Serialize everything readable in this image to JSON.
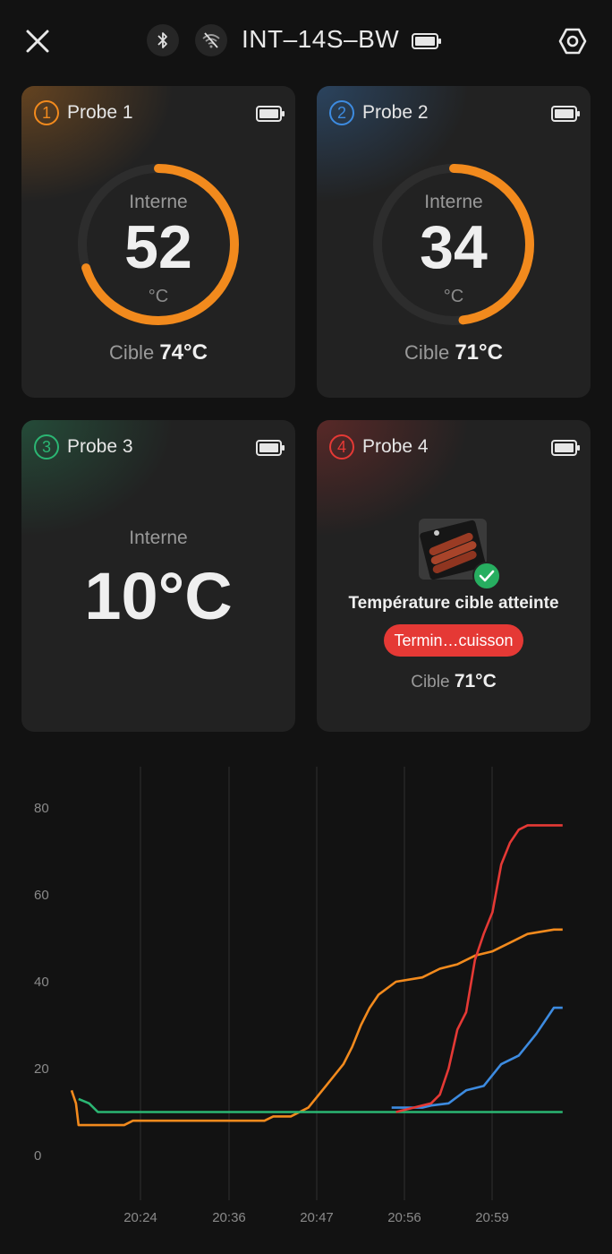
{
  "header": {
    "device_name": "INT–14S–BW",
    "icons": [
      "close-icon",
      "bluetooth-icon",
      "wifi-off-icon",
      "battery-icon",
      "settings-icon"
    ]
  },
  "probes": [
    {
      "number": "1",
      "name": "Probe 1",
      "color": "#f28a1d",
      "label": "Interne",
      "temp": "52",
      "unit": "°C",
      "target_label": "Cible",
      "target": "74°C",
      "progress": 0.7
    },
    {
      "number": "2",
      "name": "Probe 2",
      "color": "#3d8be0",
      "label": "Interne",
      "temp": "34",
      "unit": "°C",
      "target_label": "Cible",
      "target": "71°C",
      "progress": 0.48
    },
    {
      "number": "3",
      "name": "Probe 3",
      "color": "#2bb673",
      "label": "Interne",
      "temp": "10°C"
    },
    {
      "number": "4",
      "name": "Probe 4",
      "color": "#e53935",
      "status": "Température cible atteinte",
      "button": "Termin…cuisson",
      "target_label": "Cible",
      "target": "71°C"
    }
  ],
  "chart_data": {
    "type": "line",
    "y_ticks": [
      "80",
      "60",
      "40",
      "20",
      "0"
    ],
    "x_ticks": [
      "20:24",
      "20:36",
      "20:47",
      "20:56",
      "20:59"
    ],
    "ylim": [
      0,
      90
    ],
    "series": [
      {
        "color": "#f28a1d",
        "points": [
          [
            0,
            15
          ],
          [
            0.5,
            12
          ],
          [
            0.8,
            7
          ],
          [
            6,
            7
          ],
          [
            7,
            8
          ],
          [
            22,
            8
          ],
          [
            23,
            9
          ],
          [
            25,
            9
          ],
          [
            26,
            10
          ],
          [
            27,
            11
          ],
          [
            29,
            16
          ],
          [
            31,
            21
          ],
          [
            32,
            25
          ],
          [
            33,
            30
          ],
          [
            34,
            34
          ],
          [
            35,
            37
          ],
          [
            37,
            40
          ],
          [
            40,
            41
          ],
          [
            42,
            43
          ],
          [
            44,
            44
          ],
          [
            46,
            46
          ],
          [
            48,
            47
          ],
          [
            50,
            49
          ],
          [
            52,
            51
          ],
          [
            55,
            52
          ],
          [
            56,
            52
          ]
        ]
      },
      {
        "color": "#2bb673",
        "points": [
          [
            0.8,
            13
          ],
          [
            2,
            12
          ],
          [
            3,
            10
          ],
          [
            56,
            10
          ]
        ]
      },
      {
        "color": "#3d8be0",
        "points": [
          [
            36.5,
            11
          ],
          [
            40,
            11
          ],
          [
            41,
            11.5
          ],
          [
            43,
            12
          ],
          [
            45,
            15
          ],
          [
            47,
            16
          ],
          [
            49,
            21
          ],
          [
            51,
            23
          ],
          [
            53,
            28
          ],
          [
            55,
            34
          ],
          [
            56,
            34
          ]
        ]
      },
      {
        "color": "#e53935",
        "points": [
          [
            37,
            10
          ],
          [
            39,
            11
          ],
          [
            41,
            12
          ],
          [
            42,
            14
          ],
          [
            43,
            20
          ],
          [
            44,
            29
          ],
          [
            45,
            33
          ],
          [
            46,
            45
          ],
          [
            47,
            51
          ],
          [
            48,
            56
          ],
          [
            49,
            67
          ],
          [
            50,
            72
          ],
          [
            51,
            75
          ],
          [
            52,
            76
          ],
          [
            56,
            76
          ]
        ]
      }
    ]
  }
}
